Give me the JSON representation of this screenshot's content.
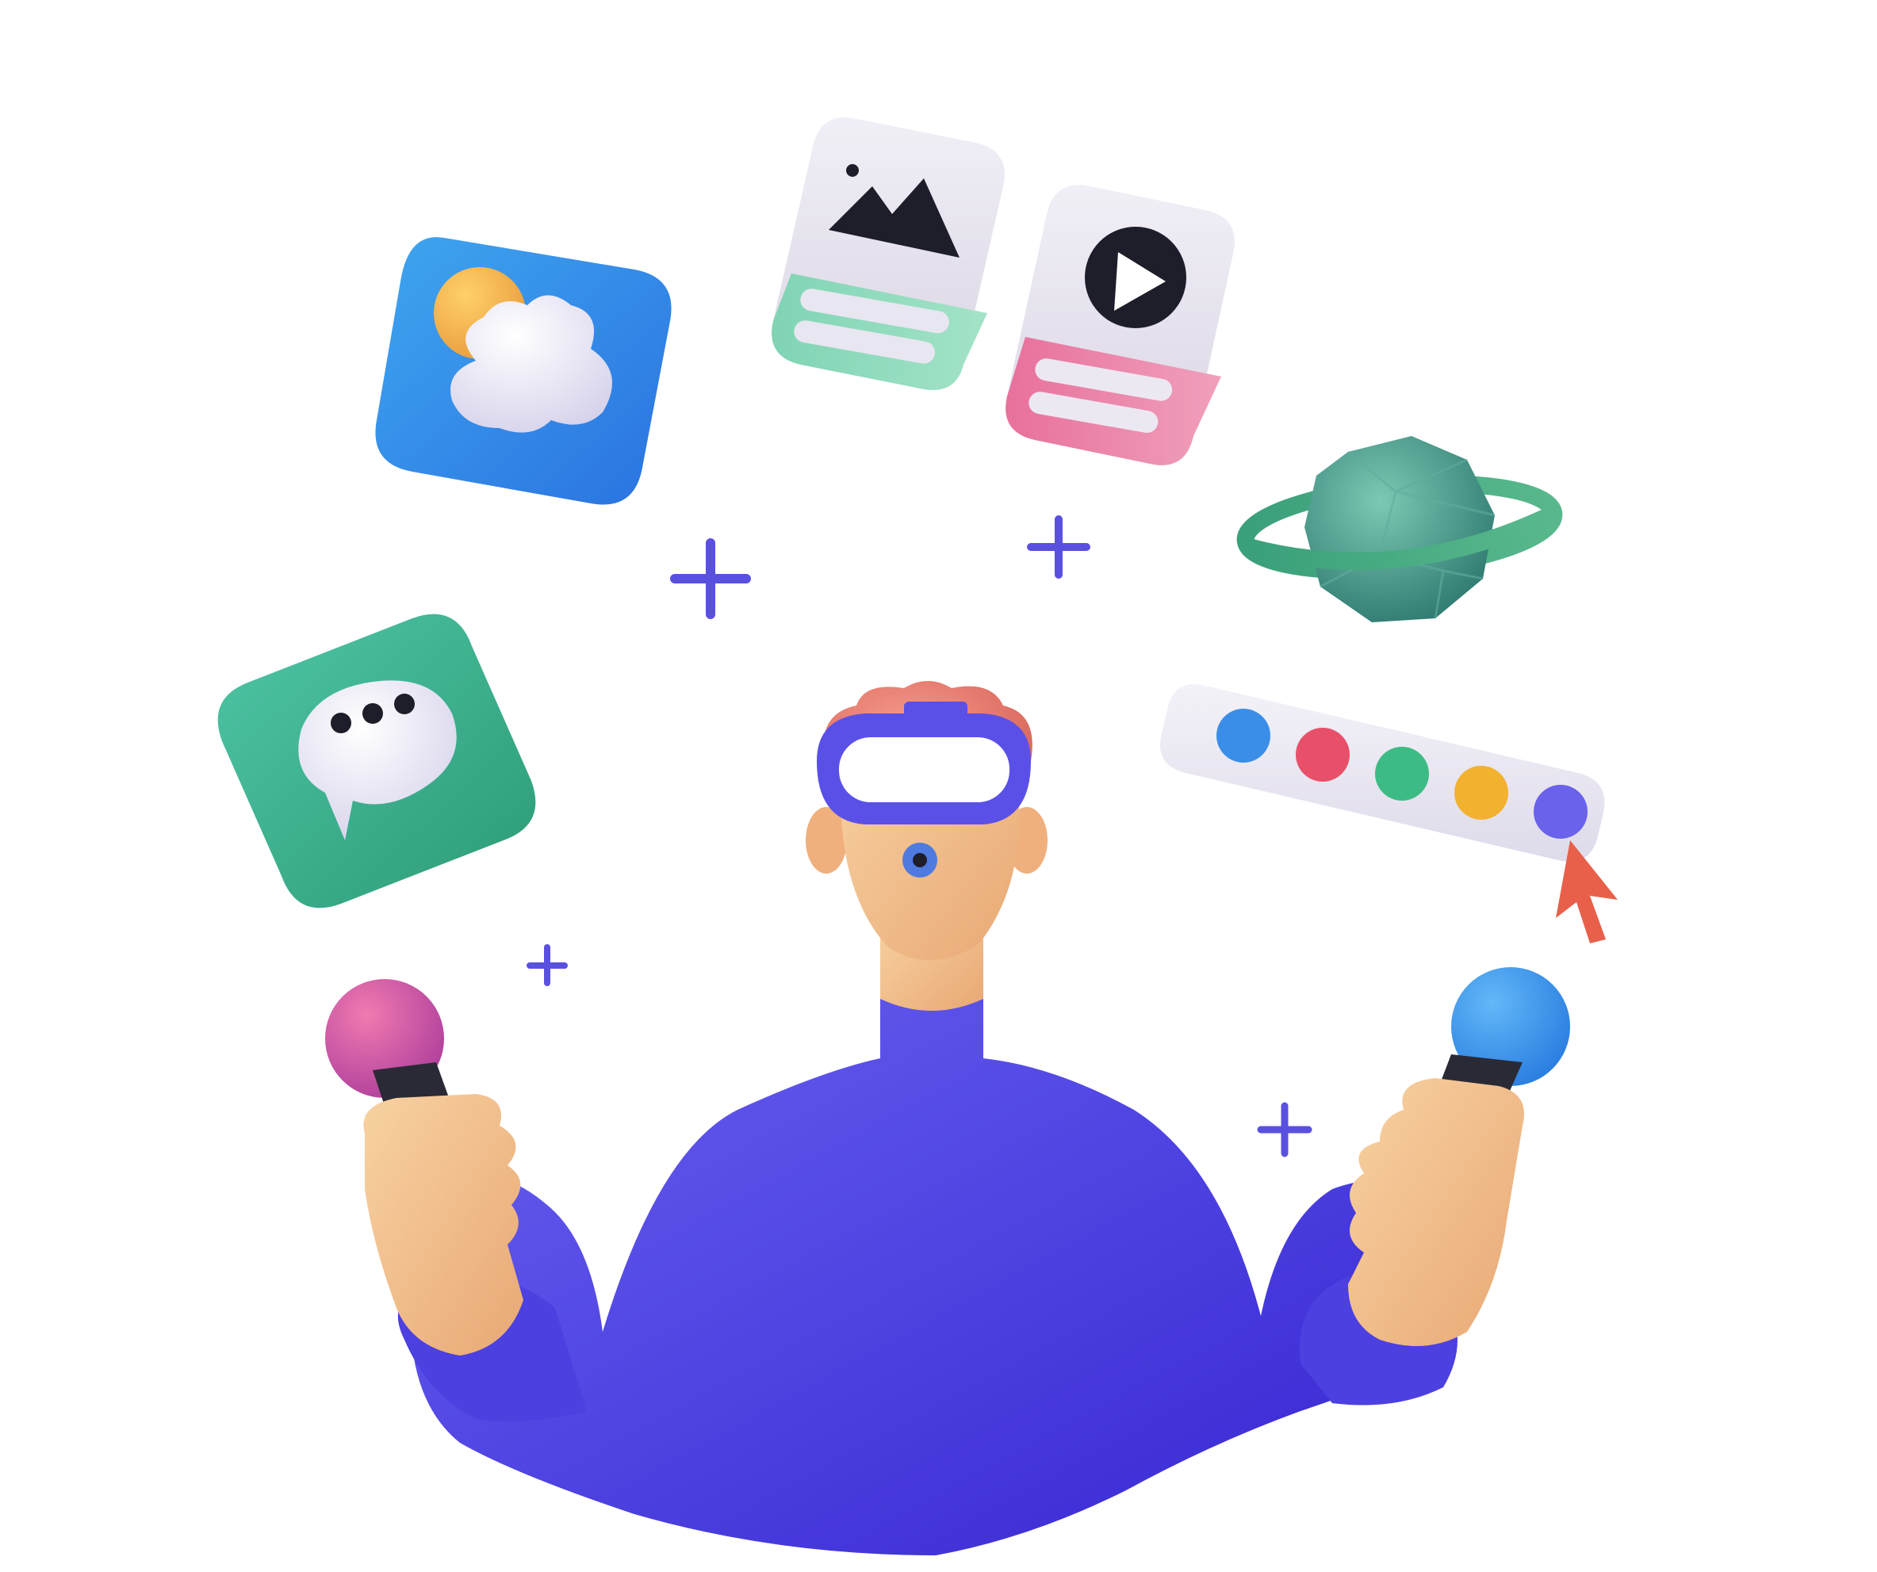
{
  "scene": {
    "background": "#ffffff",
    "subject": "person-wearing-vr-headset",
    "floating_icons": [
      {
        "name": "weather-app-icon",
        "color": "#3a8ee8"
      },
      {
        "name": "image-card-icon",
        "color": "#8fd6bd"
      },
      {
        "name": "video-card-icon",
        "color": "#e884a8"
      },
      {
        "name": "planet-icon",
        "color": "#4aa088"
      },
      {
        "name": "chat-app-icon",
        "color": "#3db88a"
      },
      {
        "name": "color-palette-bar",
        "colors": [
          "#3a8ee8",
          "#e8506a",
          "#3dbb84",
          "#f2b12e",
          "#6a62ea"
        ]
      },
      {
        "name": "cursor-icon",
        "color": "#e8604a"
      }
    ],
    "accent": "#5a50e8",
    "sparkle_color": "#5a50e0"
  }
}
